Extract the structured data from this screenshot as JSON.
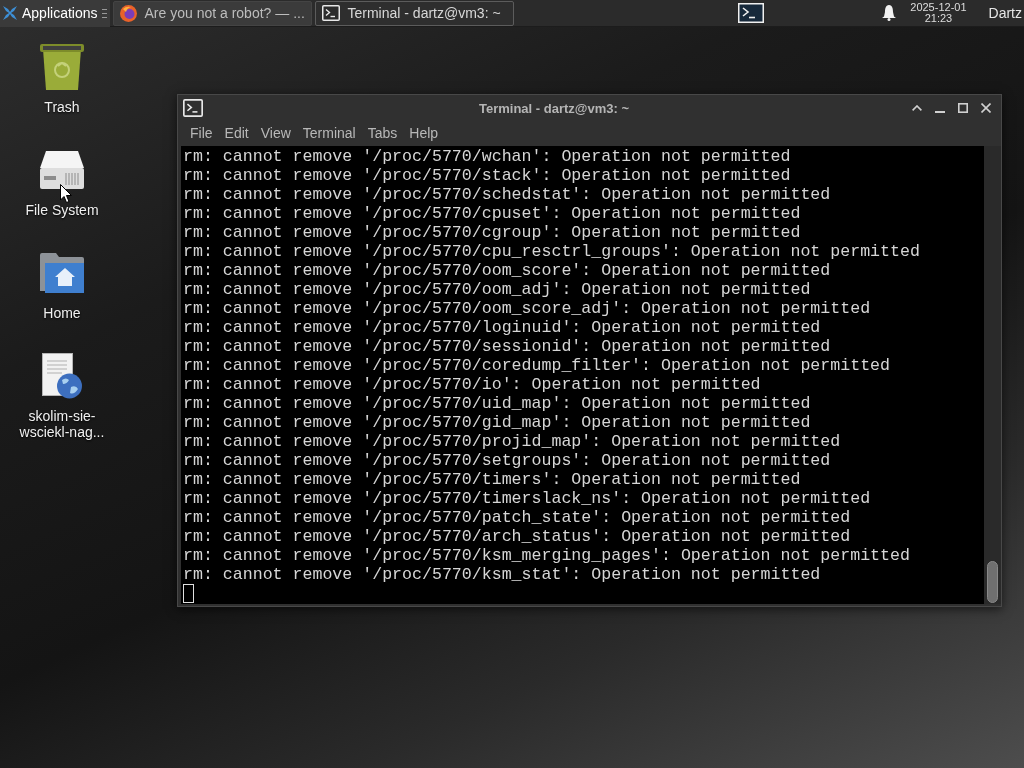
{
  "panel": {
    "applications_menu": "Applications",
    "tasks": [
      {
        "title": "Are you not a robot? — ...",
        "kind": "browser",
        "selected": false
      },
      {
        "title": "Terminal - dartz@vm3: ~",
        "kind": "terminal",
        "selected": true
      }
    ],
    "date": "2025-12-01",
    "time": "21:23",
    "user": "Dartz"
  },
  "desktop_icons": [
    {
      "label": "Trash",
      "kind": "trash"
    },
    {
      "label": "File System",
      "kind": "drive"
    },
    {
      "label": "Home",
      "kind": "home"
    },
    {
      "label": "skolim-sie-wsciekl-nag...",
      "kind": "web-document"
    }
  ],
  "terminal": {
    "title": "Terminal - dartz@vm3: ~",
    "menu": [
      "File",
      "Edit",
      "View",
      "Terminal",
      "Tabs",
      "Help"
    ],
    "lines": [
      "rm: cannot remove '/proc/5770/wchan': Operation not permitted",
      "rm: cannot remove '/proc/5770/stack': Operation not permitted",
      "rm: cannot remove '/proc/5770/schedstat': Operation not permitted",
      "rm: cannot remove '/proc/5770/cpuset': Operation not permitted",
      "rm: cannot remove '/proc/5770/cgroup': Operation not permitted",
      "rm: cannot remove '/proc/5770/cpu_resctrl_groups': Operation not permitted",
      "rm: cannot remove '/proc/5770/oom_score': Operation not permitted",
      "rm: cannot remove '/proc/5770/oom_adj': Operation not permitted",
      "rm: cannot remove '/proc/5770/oom_score_adj': Operation not permitted",
      "rm: cannot remove '/proc/5770/loginuid': Operation not permitted",
      "rm: cannot remove '/proc/5770/sessionid': Operation not permitted",
      "rm: cannot remove '/proc/5770/coredump_filter': Operation not permitted",
      "rm: cannot remove '/proc/5770/io': Operation not permitted",
      "rm: cannot remove '/proc/5770/uid_map': Operation not permitted",
      "rm: cannot remove '/proc/5770/gid_map': Operation not permitted",
      "rm: cannot remove '/proc/5770/projid_map': Operation not permitted",
      "rm: cannot remove '/proc/5770/setgroups': Operation not permitted",
      "rm: cannot remove '/proc/5770/timers': Operation not permitted",
      "rm: cannot remove '/proc/5770/timerslack_ns': Operation not permitted",
      "rm: cannot remove '/proc/5770/patch_state': Operation not permitted",
      "rm: cannot remove '/proc/5770/arch_status': Operation not permitted",
      "rm: cannot remove '/proc/5770/ksm_merging_pages': Operation not permitted",
      "rm: cannot remove '/proc/5770/ksm_stat': Operation not permitted"
    ]
  }
}
